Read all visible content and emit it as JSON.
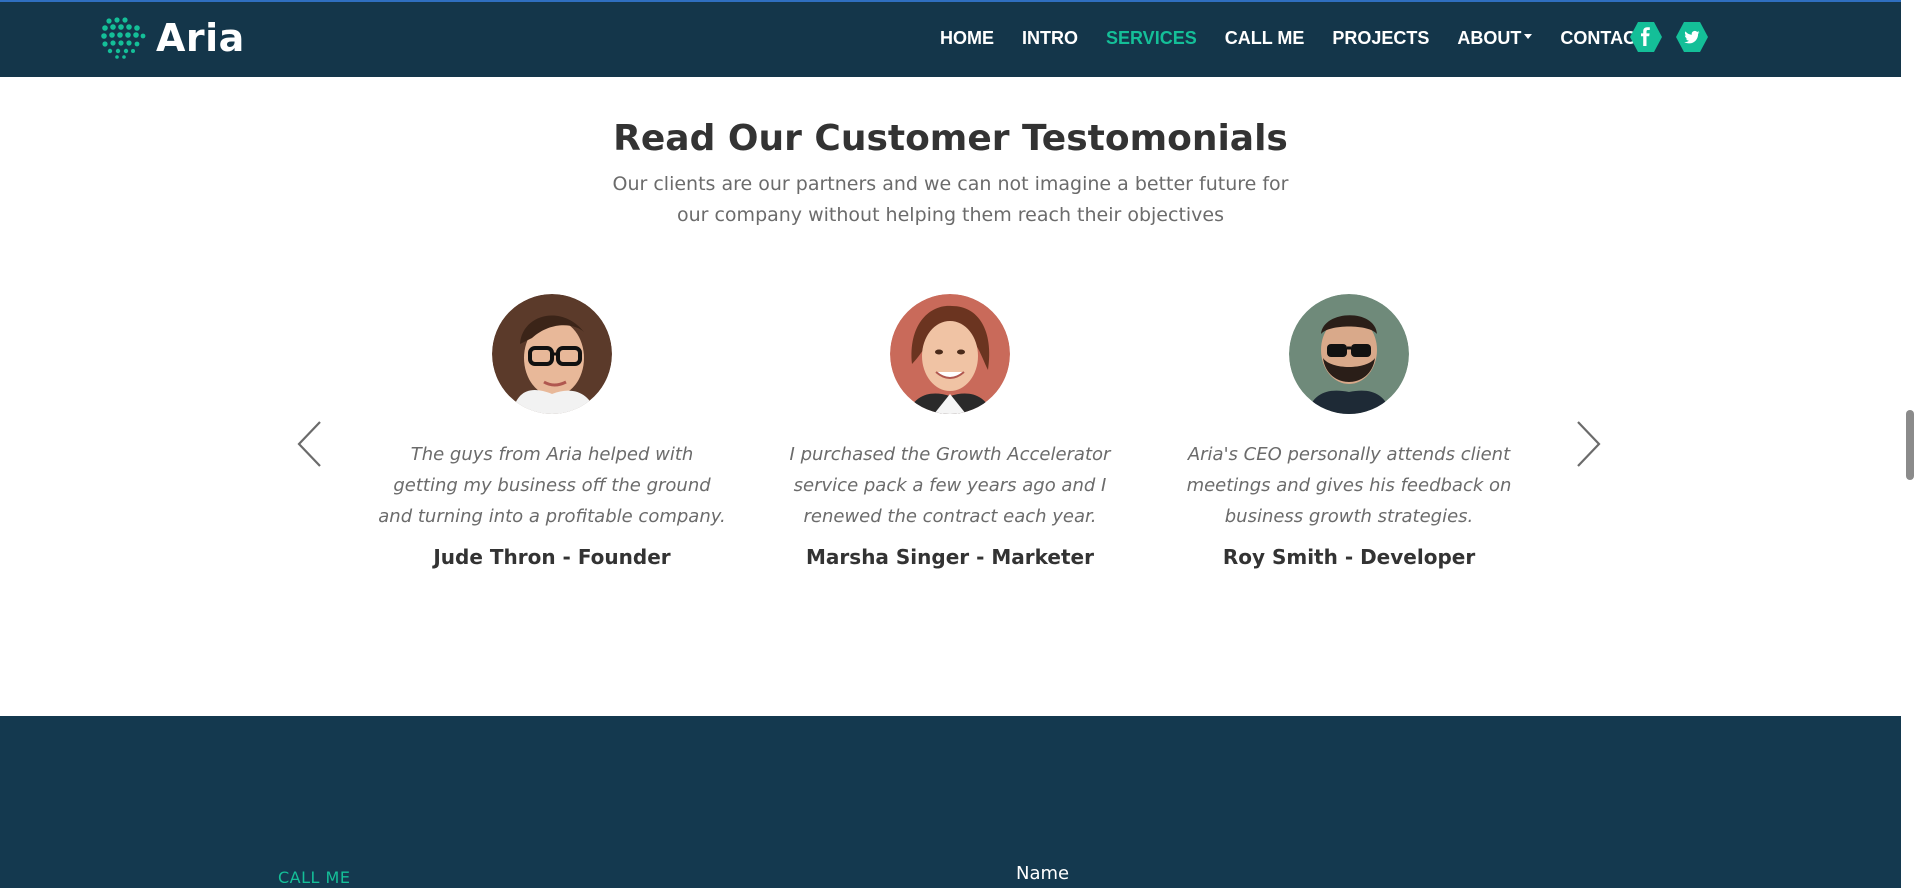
{
  "navbar": {
    "logo_text": "Aria",
    "links": [
      {
        "label": "HOME"
      },
      {
        "label": "INTRO"
      },
      {
        "label": "SERVICES"
      },
      {
        "label": "CALL ME"
      },
      {
        "label": "PROJECTS"
      },
      {
        "label": "ABOUT"
      },
      {
        "label": "CONTACT"
      }
    ],
    "active_link": "SERVICES",
    "social_icons": [
      "facebook-icon",
      "twitter-icon"
    ]
  },
  "testimonials": {
    "title": "Read Our Customer Testomonials",
    "subtitle_line1": "Our clients are our partners and we can not imagine a better future for",
    "subtitle_line2": "our company without helping them reach their objectives",
    "items": [
      {
        "quote": "The guys from Aria helped with getting my business off the ground and turning into a profitable company.",
        "author": "Jude Thron - Founder"
      },
      {
        "quote": "I purchased the Growth Accelerator service pack a few years ago and I renewed the contract each year.",
        "author": "Marsha Singer - Marketer"
      },
      {
        "quote": "Aria's CEO personally attends client meetings and gives his feedback on business growth strategies.",
        "author": "Roy Smith - Developer"
      }
    ]
  },
  "callme": {
    "label": "CALL ME",
    "name_label": "Name"
  },
  "colors": {
    "navbar_bg": "#14364a",
    "accent": "#14bf98",
    "footer_bg": "#14394f",
    "heading": "#333333",
    "body_text": "#6b6b6b"
  }
}
